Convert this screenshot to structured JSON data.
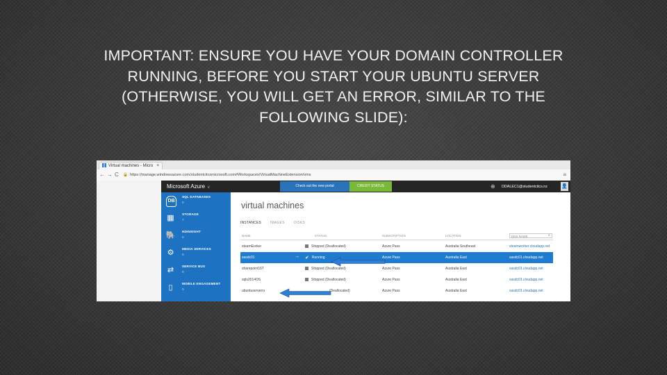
{
  "headline": [
    "IMPORTANT: ENSURE YOU HAVE YOUR DOMAIN CONTROLLER",
    "RUNNING, BEFORE YOU START YOUR UBUNTU SERVER",
    "(OTHERWISE,  YOU WILL GET AN ERROR, SIMILAR TO THE",
    "FOLLOWING SLIDE):"
  ],
  "browser": {
    "tab_title": "Virtual machines - Micro",
    "tab_close": "×",
    "back": "←",
    "forward": "→",
    "reload": "C",
    "url": "https://manage.windowsazure.com/studentcitcsmicrosoft.com#Workspaces/VirtualMachineExtension/vms",
    "lock": "🔒",
    "menu": "≡"
  },
  "portal": {
    "brand": "Microsoft Azure",
    "brand_chevron": "∨",
    "new_portal_button": "Check out the new portal",
    "credit_status_button": "CREDIT STATUS",
    "user": "DDALEC1@studentcitcs.nz",
    "page_title": "virtual machines",
    "subtabs": [
      "INSTANCES",
      "IMAGES",
      "DISKS"
    ],
    "services": [
      {
        "name": "SQL DATABASES",
        "count": "0",
        "icon": "sql-database-icon",
        "glyph": "DB"
      },
      {
        "name": "STORAGE",
        "count": "7",
        "icon": "storage-icon",
        "glyph": "▦"
      },
      {
        "name": "HDINSIGHT",
        "count": "0",
        "icon": "hdinsight-icon",
        "glyph": "🐘"
      },
      {
        "name": "MEDIA SERVICES",
        "count": "0",
        "icon": "media-services-icon",
        "glyph": "⚙"
      },
      {
        "name": "SERVICE BUS",
        "count": "0",
        "icon": "service-bus-icon",
        "glyph": "⇄"
      },
      {
        "name": "MOBILE ENGAGEMENT",
        "count": "0",
        "icon": "mobile-engagement-icon",
        "glyph": "▯"
      }
    ],
    "table": {
      "headers": {
        "name": "NAME",
        "status": "STATUS",
        "subscription": "SUBSCRIPTION",
        "location": "LOCATION",
        "dns": "DNS NAME"
      },
      "search_icon": "⌕",
      "rows": [
        {
          "name": "steamEorker",
          "status": "Stopped (Deallocated)",
          "subscription": "Azure Pass",
          "location": "Australia Southeast",
          "dns": "steamworker.cloudapp.net",
          "state": "stopped"
        },
        {
          "name": "sasdc01",
          "status": "Running",
          "subscription": "Azure Pass",
          "location": "Australia East",
          "dns": "sasdc01.cloudapp.net",
          "state": "running"
        },
        {
          "name": "sharepoint16T",
          "status": "Stopped (Deallocated)",
          "subscription": "Azure Pass",
          "location": "Australia East",
          "dns": "sasdc01.cloudapp.net",
          "state": "stopped"
        },
        {
          "name": "sqls2014OS",
          "status": "Stopped (Deallocated)",
          "subscription": "Azure Pass",
          "location": "Australia East",
          "dns": "sasdc01.cloudapp.net",
          "state": "stopped"
        },
        {
          "name": "ubuntuserverrs",
          "status": "(Deallocated)",
          "subscription": "Azure Pass",
          "location": "Australia East",
          "dns": "sasdc01.cloudapp.net",
          "state": "stopped"
        }
      ]
    },
    "annotation_color": "#2d7fd6"
  }
}
